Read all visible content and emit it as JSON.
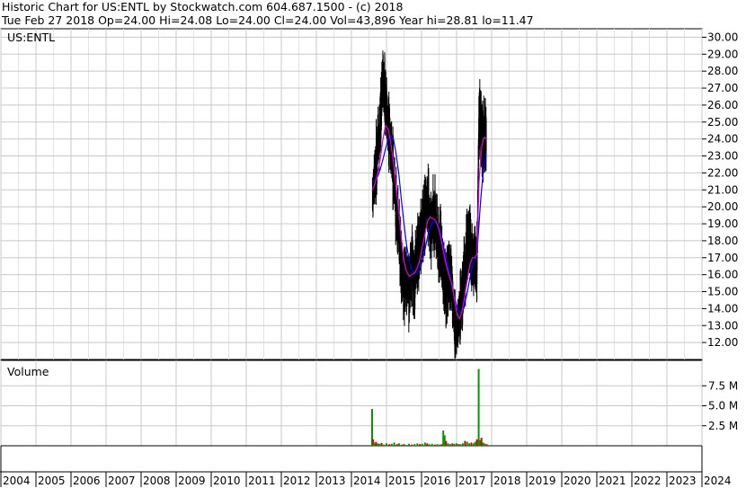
{
  "header": {
    "line1": "Historic Chart for US:ENTL by Stockwatch.com 604.687.1500 - (c) 2018",
    "line2": "Tue Feb 27 2018   Op=24.00   Hi=24.08   Lo=24.00   Cl=24.00   Vol=43,896   Year hi=28.81   lo=11.47"
  },
  "chart_data": [
    {
      "type": "line",
      "title": "US:ENTL",
      "ylim": [
        11.0,
        30.5
      ],
      "yticks": [
        "12.00",
        "13.00",
        "14.00",
        "15.00",
        "16.00",
        "17.00",
        "18.00",
        "19.00",
        "20.00",
        "21.00",
        "22.00",
        "23.00",
        "24.00",
        "25.00",
        "26.00",
        "27.00",
        "28.00",
        "29.00",
        "30.00"
      ],
      "grid": true,
      "x": [
        2014.6,
        2014.68,
        2014.75,
        2014.82,
        2014.9,
        2014.97,
        2015.05,
        2015.12,
        2015.2,
        2015.27,
        2015.35,
        2015.42,
        2015.5,
        2015.57,
        2015.65,
        2015.72,
        2015.8,
        2015.88,
        2015.95,
        2016.02,
        2016.1,
        2016.18,
        2016.25,
        2016.33,
        2016.4,
        2016.48,
        2016.55,
        2016.62,
        2016.7,
        2016.78,
        2016.85,
        2016.92,
        2017.0,
        2017.08,
        2017.15,
        2017.22,
        2017.3,
        2017.38,
        2017.45,
        2017.52,
        2017.58,
        2017.64,
        2017.68,
        2017.72,
        2017.76,
        2017.8,
        2017.85
      ],
      "series": [
        {
          "values": [
            20.5,
            22.0,
            23.5,
            24.8,
            27.5,
            26.2,
            24.5,
            23.8,
            22.0,
            20.0,
            18.5,
            16.5,
            15.5,
            16.0,
            15.2,
            16.8,
            15.5,
            17.2,
            17.8,
            18.5,
            19.8,
            20.5,
            18.5,
            19.5,
            19.2,
            18.0,
            17.5,
            16.5,
            15.0,
            16.2,
            15.8,
            13.5,
            12.5,
            13.8,
            14.5,
            16.0,
            17.5,
            18.0,
            16.5,
            17.2,
            16.0,
            24.8,
            25.2,
            24.2,
            24.0,
            24.1,
            24.0
          ]
        },
        {
          "values": [
            21.0,
            21.4,
            22.0,
            22.8,
            24.0,
            24.8,
            24.6,
            23.8,
            22.6,
            21.2,
            19.8,
            18.2,
            16.8,
            16.2,
            15.9,
            16.0,
            16.1,
            16.4,
            16.9,
            17.6,
            18.4,
            19.2,
            19.4,
            19.3,
            19.2,
            18.8,
            18.2,
            17.4,
            16.6,
            16.0,
            15.6,
            14.8,
            13.8,
            13.4,
            13.8,
            14.6,
            15.6,
            16.6,
            17.0,
            17.0,
            17.2,
            21.5,
            22.6,
            23.6,
            24.0,
            24.1,
            24.0
          ]
        },
        {
          "values": [
            21.5,
            21.6,
            21.8,
            22.2,
            22.8,
            23.4,
            24.0,
            24.2,
            24.0,
            23.2,
            22.0,
            20.5,
            19.0,
            17.8,
            16.8,
            16.3,
            16.1,
            16.1,
            16.3,
            16.8,
            17.5,
            18.3,
            18.8,
            19.1,
            19.1,
            18.9,
            18.4,
            17.7,
            16.9,
            16.2,
            15.5,
            14.8,
            14.2,
            13.8,
            13.8,
            14.2,
            14.9,
            15.8,
            16.5,
            16.9,
            17.2,
            19.0,
            20.2,
            21.2,
            22.0,
            22.7,
            23.2
          ]
        }
      ]
    },
    {
      "type": "bar",
      "title": "Volume",
      "yticks": [
        "2.5 M",
        "5.0 M",
        "7.5 M"
      ],
      "ylim": [
        0,
        10.0
      ],
      "volume_m": [
        [
          2014.59,
          4.6
        ],
        [
          2014.62,
          0.8
        ],
        [
          2014.64,
          0.4
        ],
        [
          2014.66,
          0.2
        ],
        [
          2014.7,
          0.5
        ],
        [
          2014.75,
          0.3
        ],
        [
          2014.8,
          0.25
        ],
        [
          2014.86,
          0.35
        ],
        [
          2014.92,
          0.15
        ],
        [
          2015.0,
          0.3
        ],
        [
          2015.08,
          0.2
        ],
        [
          2015.15,
          0.25
        ],
        [
          2015.22,
          0.4
        ],
        [
          2015.3,
          0.2
        ],
        [
          2015.36,
          0.3
        ],
        [
          2015.44,
          0.15
        ],
        [
          2015.5,
          0.2
        ],
        [
          2015.58,
          0.1
        ],
        [
          2015.64,
          0.25
        ],
        [
          2015.72,
          0.15
        ],
        [
          2015.8,
          0.2
        ],
        [
          2015.88,
          0.3
        ],
        [
          2015.95,
          0.2
        ],
        [
          2016.02,
          0.25
        ],
        [
          2016.1,
          0.4
        ],
        [
          2016.16,
          0.3
        ],
        [
          2016.22,
          0.2
        ],
        [
          2016.3,
          0.25
        ],
        [
          2016.38,
          0.15
        ],
        [
          2016.45,
          0.2
        ],
        [
          2016.52,
          0.15
        ],
        [
          2016.58,
          0.2
        ],
        [
          2016.62,
          1.9
        ],
        [
          2016.66,
          1.3
        ],
        [
          2016.7,
          0.6
        ],
        [
          2016.76,
          0.3
        ],
        [
          2016.82,
          0.2
        ],
        [
          2016.88,
          0.3
        ],
        [
          2016.94,
          0.25
        ],
        [
          2017.0,
          0.3
        ],
        [
          2017.06,
          0.2
        ],
        [
          2017.12,
          0.2
        ],
        [
          2017.18,
          0.3
        ],
        [
          2017.24,
          0.6
        ],
        [
          2017.3,
          0.5
        ],
        [
          2017.36,
          0.3
        ],
        [
          2017.42,
          0.4
        ],
        [
          2017.48,
          0.3
        ],
        [
          2017.53,
          0.5
        ],
        [
          2017.58,
          0.8
        ],
        [
          2017.63,
          9.6
        ],
        [
          2017.67,
          0.7
        ],
        [
          2017.71,
          1.0
        ],
        [
          2017.75,
          0.4
        ],
        [
          2017.8,
          0.3
        ],
        [
          2017.86,
          0.2
        ]
      ]
    }
  ],
  "xaxis": {
    "labels": [
      "2004",
      "2005",
      "2006",
      "2007",
      "2008",
      "2009",
      "2010",
      "2011",
      "2012",
      "2013",
      "2014",
      "2015",
      "2016",
      "2017",
      "2018",
      "2019",
      "2020",
      "2021",
      "2022",
      "2023",
      "2024"
    ]
  },
  "colors": {
    "grid": "#c8c8c8",
    "price": "#000000",
    "ma_short": "#e000e0",
    "ma_long": "#0000ff",
    "vol_up": "#009900",
    "vol_down": "#dd0000"
  }
}
